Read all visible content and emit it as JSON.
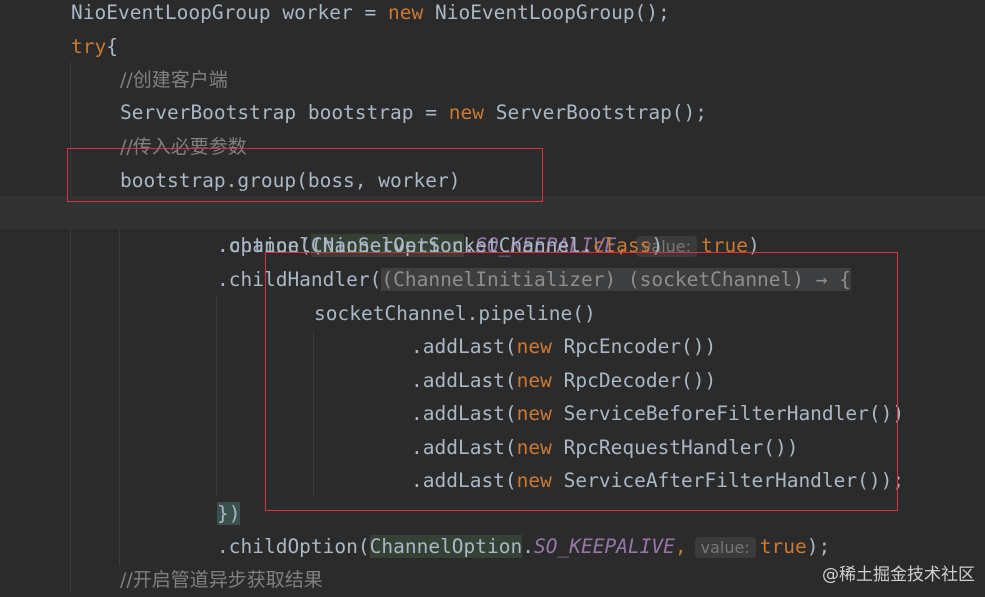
{
  "code": {
    "l1_type": "NioEventLoopGroup",
    "l1_var": " worker = ",
    "l1_new": "new",
    "l1_ctor": " NioEventLoopGroup();",
    "l2_try": "try",
    "l2_brace": "{",
    "l3_comment": "//创建客户端",
    "l4_type": "ServerBootstrap bootstrap = ",
    "l4_new": "new",
    "l4_ctor": " ServerBootstrap();",
    "l5_comment": "//传入必要参数",
    "l6_call": "bootstrap.group(boss, worker)",
    "l7_pre": ".option(",
    "l7_class": "ChannelOption",
    "l7_dot": ".",
    "l7_field": "SO_KEEPALIVE",
    "l7_comma": ",",
    "l7_hint": "value:",
    "l7_true": "true",
    "l7_close": ")",
    "l8_pre": ".channel(NioServerSocketChannel.",
    "l8_class": "class",
    "l8_close": ")",
    "l9_pre": ".childHandler(",
    "l9_lambda": "(ChannelInitializer) (socketChannel) → {",
    "l10": "socketChannel.pipeline()",
    "add_pre": ".addLast(",
    "add_new": "new",
    "add1": " RpcEncoder())",
    "add2": " RpcDecoder())",
    "add3": " ServiceBeforeFilterHandler())",
    "add4": " RpcRequestHandler())",
    "add5": " ServiceAfterFilterHandler());",
    "l16_brace": "})",
    "l17_pre": ".childOption(",
    "l17_class": "ChannelOption",
    "l17_dot": ".",
    "l17_field": "SO_KEEPALIVE",
    "l17_comma": ",",
    "l17_hint": "value:",
    "l17_true": "true",
    "l17_close": ");",
    "l18_comment": "//开启管道异步获取结果"
  },
  "watermark": "@稀土掘金技术社区",
  "colors": {
    "background": "#2b2b2b",
    "keyword": "#cc7832",
    "field": "#9876aa",
    "comment": "#808080",
    "highlight_box": "#d9323c"
  }
}
